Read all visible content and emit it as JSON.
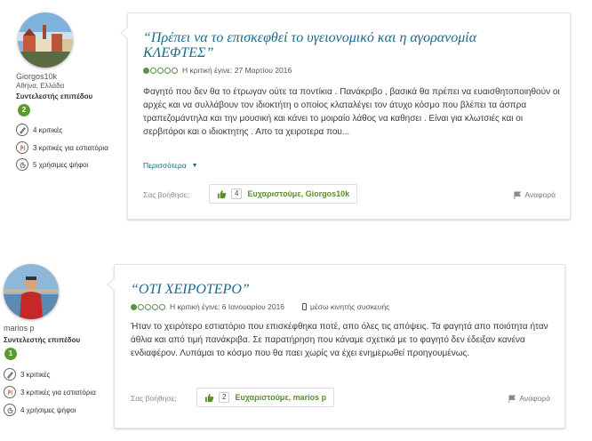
{
  "reviews": [
    {
      "reviewer": {
        "username": "Giorgos10k",
        "location": "Αθήνα, Ελλάδα",
        "level_label": "Συντελεστής επιπέδου",
        "level": "2",
        "stats": [
          {
            "icon": "pen-icon",
            "text": "4 κριτικές"
          },
          {
            "icon": "restaurant-icon",
            "text": "3 κριτικές για εστιατόρια"
          },
          {
            "icon": "thumbs-icon",
            "text": "5 χρήσιμες ψήφοι"
          }
        ]
      },
      "title": "“Πρέπει να το επισκεφθεί το υγειονομικό και η αγορανομία ΚΛΕΦΤΕΣ”",
      "rating": 1,
      "rating_max": 5,
      "date": "Η κριτική έγινε: 27 Μαρτίου 2016",
      "mobile": "",
      "text": "Φαγητό που δεν θα το έτρωγαν ούτε τα ποντίκια . Πανάκριβο , βασικά θα πρέπει να ευαισθητοποιηθούν οι αρχές και να συλλάβουν τον ιδιοκτήτη ο οποίος κλαταλέγει τον άτυχο κόσμο που βλέπει τα άσπρα τραπεζομάντηλα και την μουσική και κάνει το μοιραίο λάθος να καθησει . Είναι για κλωτσιές και οι σερβιτόροι και ο ιδιοκτητης . Απο τα χειροτερα που...",
      "more": "Περισσότερα",
      "helpful_label": "Σας βοήθησε;",
      "thanks_count": "4",
      "thanks_text": "Ευχαριστούμε, Giorgos10k",
      "report": "Αναφορά"
    },
    {
      "reviewer": {
        "username": "marios p",
        "location": "",
        "level_label": "Συντελεστής επιπέδου",
        "level": "1",
        "stats": [
          {
            "icon": "pen-icon",
            "text": "3 κριτικές"
          },
          {
            "icon": "restaurant-icon",
            "text": "3 κριτικές για εστιατόρια"
          },
          {
            "icon": "thumbs-icon",
            "text": "4 χρήσιμες ψήφοι"
          }
        ]
      },
      "title": "“ΟΤΙ ΧΕΙΡΟΤΕΡΟ”",
      "rating": 1,
      "rating_max": 5,
      "date": "Η κριτική έγινε: 6 Ιανουαρίου 2016",
      "mobile": "μέσω κινητής συσκευής",
      "text": "Ήταν το χειρότερο εστιατόριο που επισκέφθηκα ποτέ, απο όλες τις απόψεις. Τα φαγητά απο ποιότητα ήταν άθλια και από τιμή πανάκριβα. Σε παρατήρηση που κάναμε σχετικά με το φαγητό δεν έδειξαν κανένα ενδιαφέρον. Λυπάμαι το κόσμο που θα παει χωρίς να έχει ενημερωθεί προηγουμένως.",
      "more": "",
      "helpful_label": "Σας βοήθησε;",
      "thanks_count": "2",
      "thanks_text": "Ευχαριστούμε, marios p",
      "report": "Αναφορά"
    }
  ],
  "colors": {
    "link": "#1a6a8a",
    "bubble": "#589442",
    "thanks": "#5b8f2d",
    "level_badge": "#5b9b2f"
  }
}
